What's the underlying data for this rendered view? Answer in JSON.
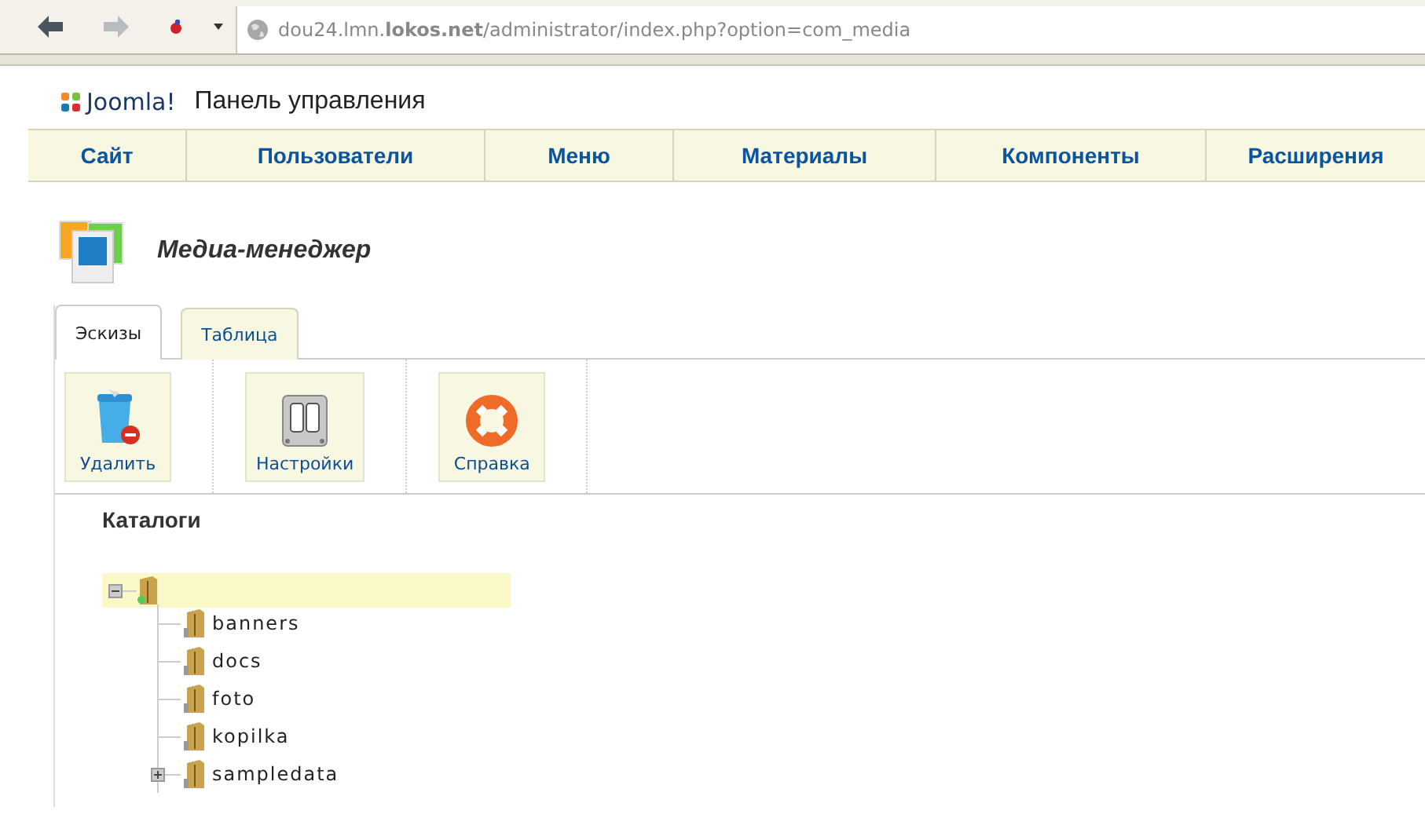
{
  "browser": {
    "back_disabled": false,
    "forward_disabled": true,
    "url": "dou24.lmn.**lokos.net**/administrator/index.php?option=com_media"
  },
  "header": {
    "logo": "Joomla!",
    "title": "Панель управления"
  },
  "menu": [
    {
      "label": "Сайт"
    },
    {
      "label": "Пользователи"
    },
    {
      "label": "Меню"
    },
    {
      "label": "Материалы"
    },
    {
      "label": "Компоненты"
    },
    {
      "label": "Расширения"
    }
  ],
  "page_title": "Медиа-менеджер",
  "tabs": [
    {
      "label": "Эскизы",
      "selected": true
    },
    {
      "label": "Таблица",
      "selected": false
    }
  ],
  "toolbar": [
    {
      "label": "Удалить",
      "kind": "delete"
    },
    {
      "label": "Настройки",
      "kind": "settings"
    },
    {
      "label": "Справка",
      "kind": "help"
    }
  ],
  "folders": {
    "heading": "Каталоги",
    "root": {
      "expanded": true,
      "selected": true,
      "children": [
        {
          "label": "banners",
          "selected": false
        },
        {
          "label": "docs",
          "selected": false
        },
        {
          "label": "foto",
          "selected": false
        },
        {
          "label": "kopilka",
          "selected": false
        },
        {
          "label": "sampledata",
          "selected": false,
          "expanded": false
        }
      ]
    }
  }
}
